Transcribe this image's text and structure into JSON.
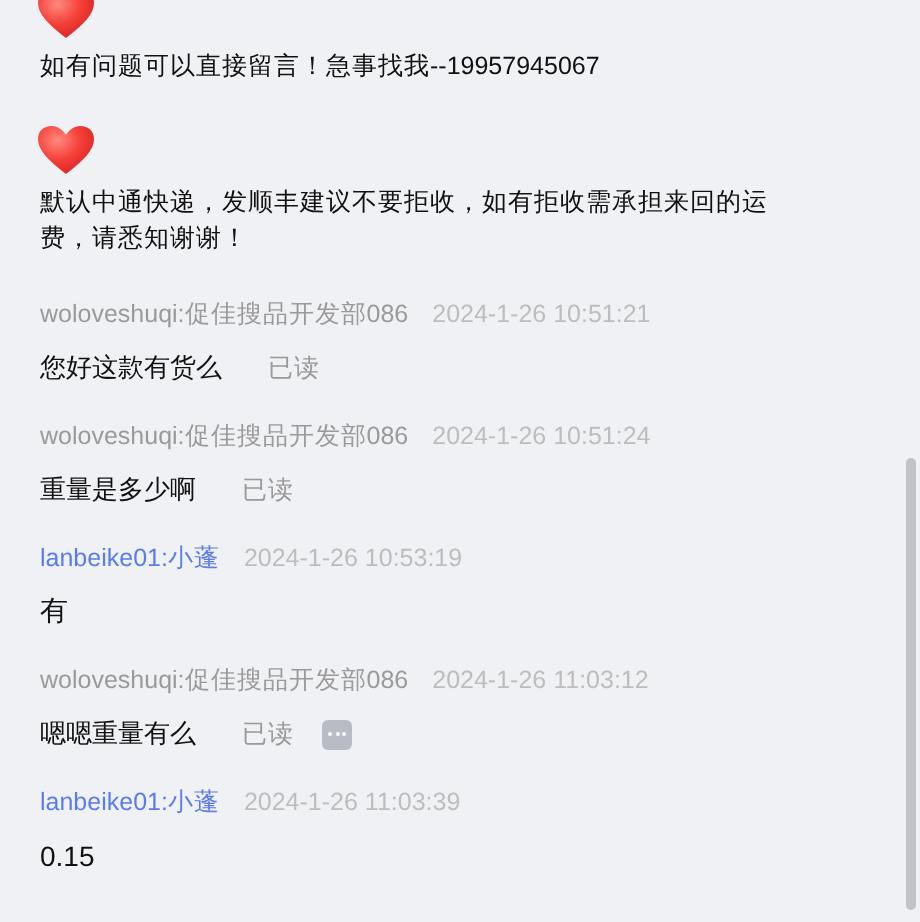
{
  "notices": [
    {
      "text": "如有问题可以直接留言！急事找我--19957945067"
    },
    {
      "text": "默认中通快递，发顺丰建议不要拒收，如有拒收需承担来回的运费，请悉知谢谢！"
    }
  ],
  "messages": [
    {
      "kind": "buyer",
      "sender": "woloveshuqi:促佳搜品开发部086",
      "time": "2024-1-26 10:51:21",
      "text": "您好这款有货么",
      "status": "已读",
      "more": false
    },
    {
      "kind": "buyer",
      "sender": "woloveshuqi:促佳搜品开发部086",
      "time": "2024-1-26 10:51:24",
      "text": "重量是多少啊",
      "status": "已读",
      "more": false
    },
    {
      "kind": "seller",
      "sender": "lanbeike01:小蓬",
      "time": "2024-1-26 10:53:19",
      "text": "有"
    },
    {
      "kind": "buyer",
      "sender": "woloveshuqi:促佳搜品开发部086",
      "time": "2024-1-26 11:03:12",
      "text": "嗯嗯重量有么",
      "status": "已读",
      "more": true
    },
    {
      "kind": "seller",
      "sender": "lanbeike01:小蓬",
      "time": "2024-1-26 11:03:39",
      "text": "0.15"
    }
  ]
}
